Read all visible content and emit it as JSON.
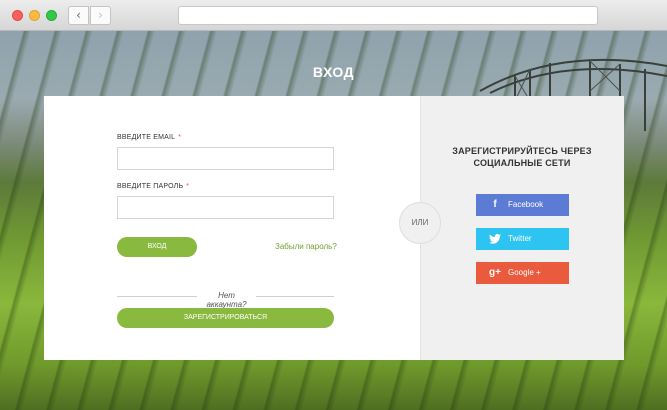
{
  "browser": {
    "back_glyph": "‹",
    "forward_glyph": "›"
  },
  "page": {
    "title": "ВХОД"
  },
  "login_form": {
    "email_label": "ВВЕДИТЕ EMAIL",
    "password_label": "ВВЕДИТЕ ПАРОЛЬ",
    "required_mark": "*",
    "email_value": "",
    "password_value": "",
    "login_button": "ВХОД",
    "forgot_link": "Забыли пароль?",
    "no_account_text": "Нет аккаунта?",
    "register_button": "ЗАРЕГИСТРИРОВАТЬСЯ"
  },
  "separator": {
    "or_text": "ИЛИ"
  },
  "social": {
    "title_line1": "ЗАРЕГИСТРИРУЙТЕСЬ ЧЕРЕЗ",
    "title_line2": "СОЦИАЛЬНЫЕ СЕТИ",
    "buttons": [
      {
        "label": "Facebook",
        "icon": "facebook-icon",
        "glyph": "f",
        "color": "#5b7bd5"
      },
      {
        "label": "Twitter",
        "icon": "twitter-icon",
        "glyph": "🐦",
        "color": "#2ec4f2"
      },
      {
        "label": "Google +",
        "icon": "google-plus-icon",
        "glyph": "g+",
        "color": "#ea5a3c"
      }
    ]
  },
  "colors": {
    "accent_green": "#8ab940",
    "link_green": "#6fa032",
    "required_red": "#d9534f"
  }
}
